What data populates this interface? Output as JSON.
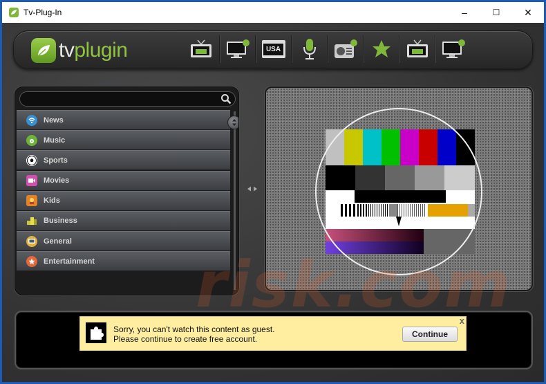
{
  "window": {
    "title": "Tv-Plug-In",
    "controls": {
      "minimize": "–",
      "maximize": "☐",
      "close": "✕"
    }
  },
  "brand": {
    "prefix": "tv",
    "suffix": "plugin"
  },
  "nav": [
    {
      "name": "tv-icon"
    },
    {
      "name": "monitor-globe-icon"
    },
    {
      "name": "usa-tv-icon",
      "label": "USA"
    },
    {
      "name": "microphone-icon"
    },
    {
      "name": "radio-icon"
    },
    {
      "name": "star-icon"
    },
    {
      "name": "tv-favorites-icon"
    },
    {
      "name": "monitor-globe-2-icon"
    }
  ],
  "search": {
    "placeholder": "",
    "value": ""
  },
  "categories": [
    {
      "label": "News",
      "icon": "wifi-icon",
      "color": "#3a8fd0"
    },
    {
      "label": "Music",
      "icon": "music-icon",
      "color": "#6fb23a"
    },
    {
      "label": "Sports",
      "icon": "soccer-ball-icon",
      "color": "#ffffff"
    },
    {
      "label": "Movies",
      "icon": "video-camera-icon",
      "color": "#d24fb0"
    },
    {
      "label": "Kids",
      "icon": "kids-icon",
      "color": "#e0842a"
    },
    {
      "label": "Business",
      "icon": "business-icon",
      "color": "#c9c43a"
    },
    {
      "label": "General",
      "icon": "tv-general-icon",
      "color": "#e0b03a"
    },
    {
      "label": "Entertainment",
      "icon": "star-badge-icon",
      "color": "#e06a3a"
    }
  ],
  "colors": {
    "accent_green": "#8fc441",
    "titlebar_bg": "#ffffff",
    "notice_bg": "#ffeea0",
    "window_border": "#1e5bb5"
  },
  "notice": {
    "line1": "Sorry, you can't watch this content as guest.",
    "line2": "Please continue to create free account.",
    "close": "x",
    "button": "Continue"
  },
  "watermark": "risk.com"
}
